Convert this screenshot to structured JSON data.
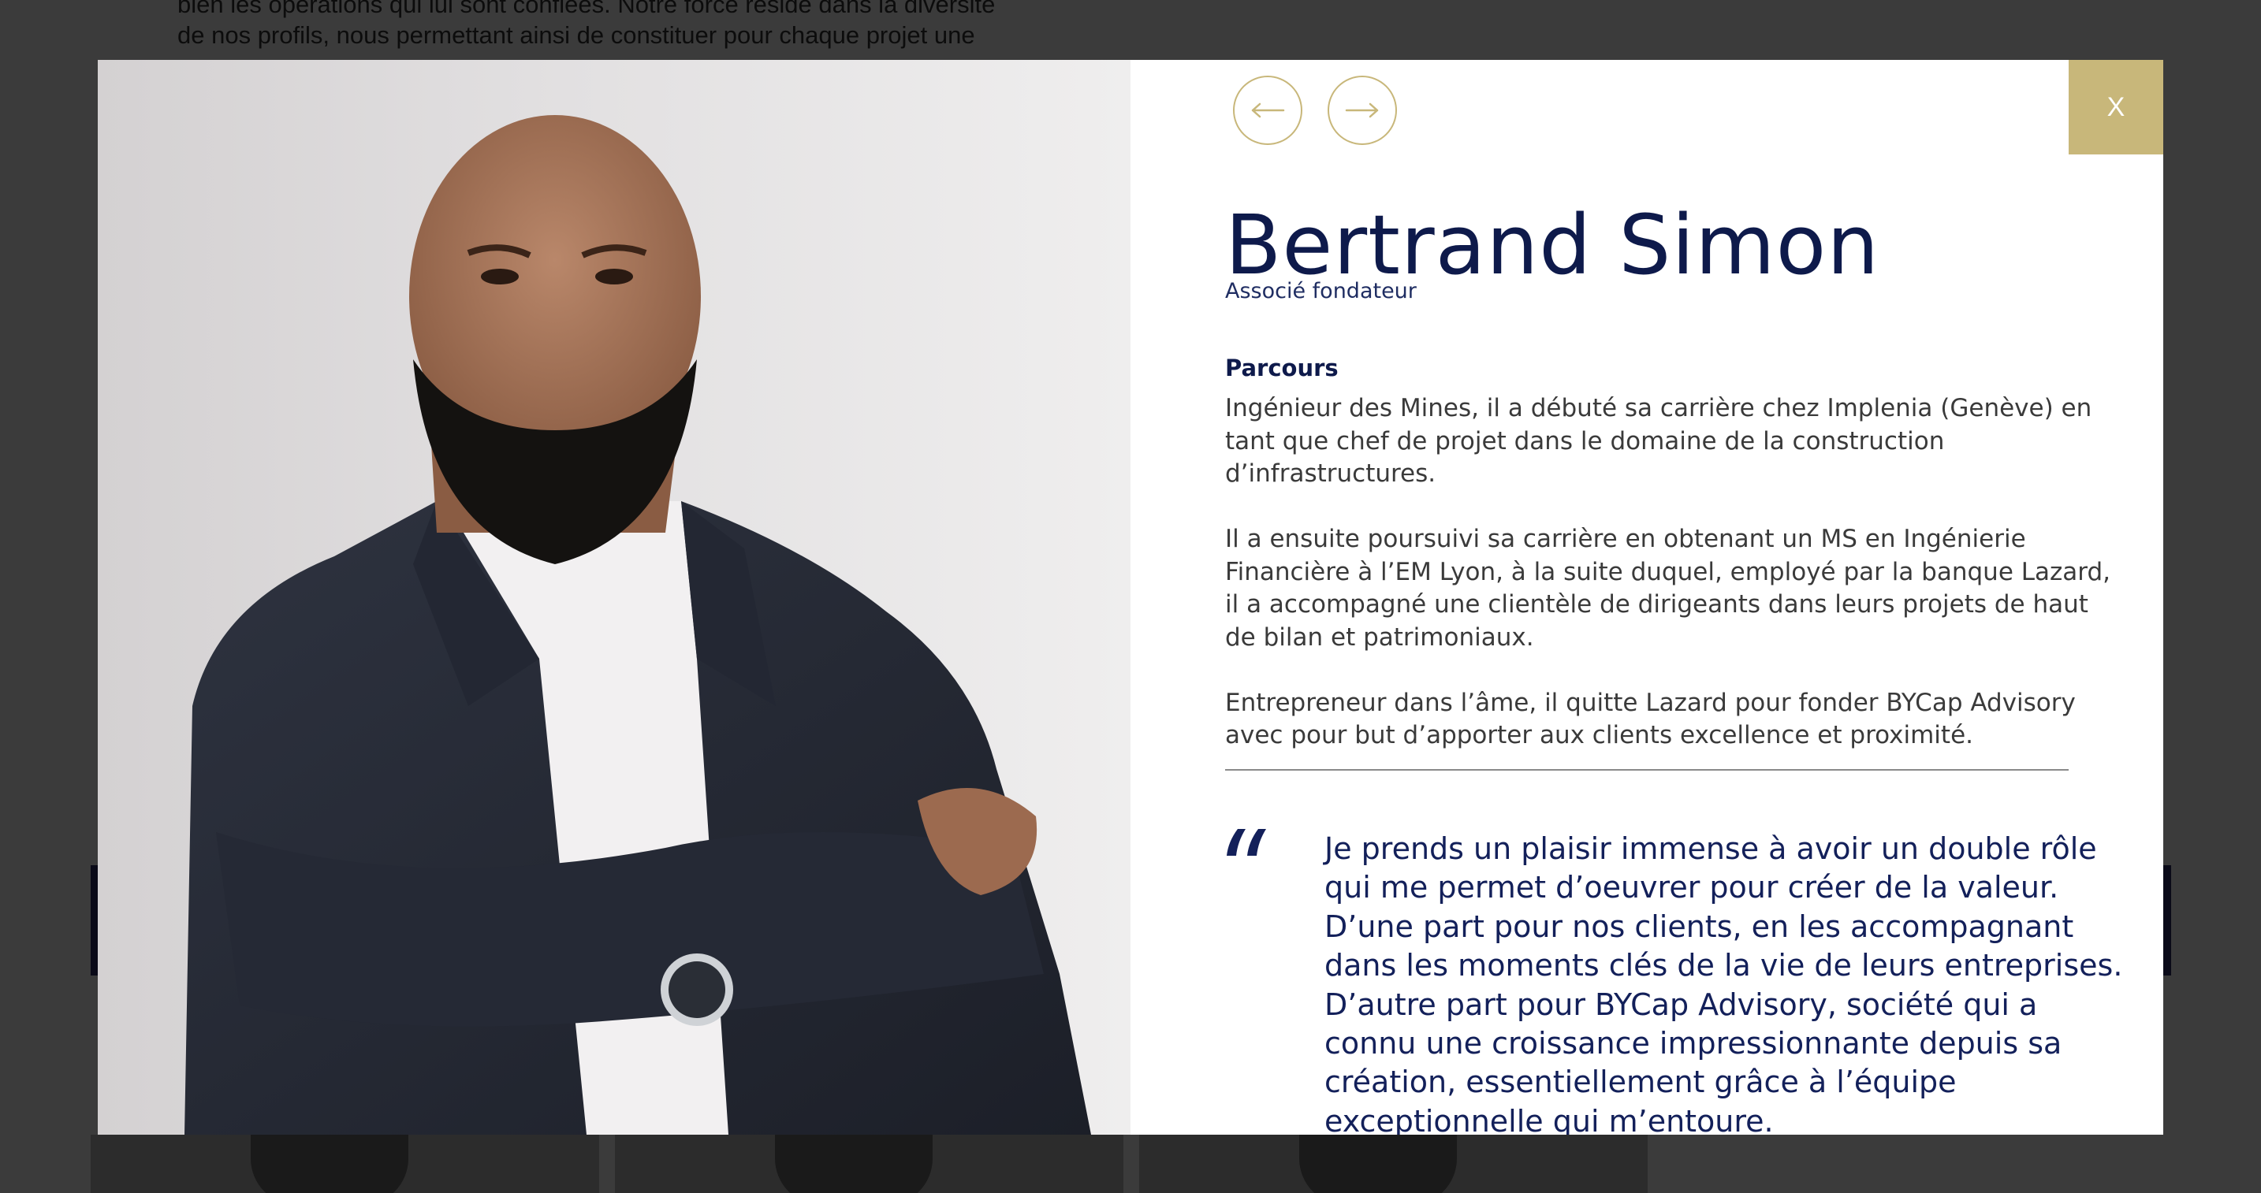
{
  "background_page": {
    "text_lines": [
      "bien les opérations qui lui sont confiées. Notre force réside dans la diversité",
      "de nos profils, nous permettant ainsi de constituer pour chaque projet une"
    ]
  },
  "modal": {
    "close_label": "X",
    "nav": {
      "prev_icon": "arrow-left-icon",
      "next_icon": "arrow-right-icon"
    },
    "person": {
      "name": "Bertrand Simon",
      "role": "Associé fondateur"
    },
    "section_title": "Parcours",
    "bio_paragraphs": [
      [
        "Ingénieur des Mines, il a débuté sa carrière chez Implenia (Genève) en",
        "tant que chef de projet dans le domaine de la construction",
        "d’infrastructures."
      ],
      [
        "Il a ensuite poursuivi sa carrière en obtenant un MS en Ingénierie",
        "Financière à l’EM Lyon, à la suite duquel, employé par la banque Lazard,",
        "il a accompagné une clientèle de dirigeants dans leurs projets de haut",
        "de bilan et patrimoniaux."
      ],
      [
        "Entrepreneur dans l’âme, il quitte Lazard pour fonder BYCap Advisory",
        "avec pour but d’apporter aux clients excellence et proximité."
      ]
    ],
    "quote_lines": [
      "Je prends un plaisir immense à avoir un double rôle",
      "qui me permet d’oeuvrer pour créer de la valeur.",
      "D’une part pour nos clients, en les accompagnant",
      "dans les moments clés de la vie de leurs entreprises.",
      "D’autre part pour BYCap Advisory, société qui a",
      "connu une croissance impressionnante depuis sa",
      "création, essentiellement grâce à l’équipe",
      "exceptionnelle qui m’entoure."
    ],
    "colors": {
      "accent_gold": "#c8b77a",
      "navy": "#0e1a4b",
      "overlay": "#3b3b3b"
    }
  }
}
